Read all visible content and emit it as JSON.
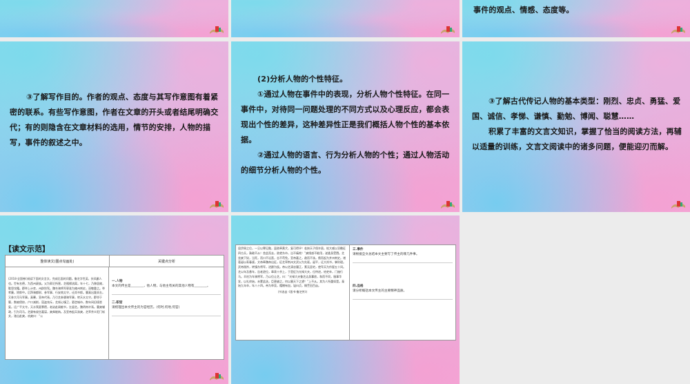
{
  "slides": {
    "s3": {
      "text": "事件的观点、情感、态度等。"
    },
    "s4": {
      "text": "③了解写作目的。作者的观点、态度与其写作意图有着紧密的联系。有些写作意图，作者在文章的开头或者结尾明确交代；有的则隐含在文章材料的选用，情节的安排，人物的描写，事件的叙述之中。"
    },
    "s5": {
      "heading": "(2)分析人物的个性特征。",
      "p1": "①通过人物在事件中的表现，分析人物个性特征。在同一事件中，对待同一问题处理的不同方式以及心理反应，都会表现出个性的差异，这种差异性正是我们概括人物个性的基本依据。",
      "p2": "②通过人物的语言、行为分析人物的个性；通过人物活动的细节分析人物的个性。"
    },
    "s6": {
      "p1": "③了解古代传记人物的基本类型：刚烈、忠贞、勇猛、爱国、诚信、孝悌、谦慎、勤勉、博闻、聪慧……",
      "p2": "积累了丰富的文言文知识，掌握了恰当的阅读方法，再辅以适量的训练，文言文阅读中的诸多问题，便能迎刃而解。"
    },
    "s7": {
      "title": "【读文示范】",
      "col1_header": "整体读文(圈点勾画处)",
      "col2_header": "关键点分析",
      "passage": "(2018·全国卷Ⅰ)阅读下面的文言文，完成后面的问题。鲁芝字世英，扶风郿人也。世有名德，为西州豪族。父为郭汜所害，芝襁褓流离，年十七，乃移居雍，耽思坟籍。郡举上计吏，州辟别驾。魏车骑将军郭淮为雍州刺史，深敬重之。举孝廉，除郎中。后拜骑都尉、参军事、行安南太守，迁尚书郎。曹真出督关右，又参大司马军事。真薨，宣帝代焉，乃引芝参骠骑军事，转天水太守。郡邻于蜀，数被侵掠，户口减削，寇盗充斥，芝倾心镇卫，更造城市，数年间旧境悉复。迁广平太守。天水夷夏慕德，老幼赴阙献书，乞留芝。魏明帝许焉。曹爽辅政，引为司马。芝屡有谠言嘉谋，爽弗能纳。及宣帝起兵诛爽，芝率余众犯门斩关，驰出赴爽，劝爽曰：“公",
      "q1_title": "一.人物",
      "q1_text": "本文的传主是________，他人物，与他主有关的其他人物有________。",
      "q2_title": "二.职官",
      "q2_text": "请梳理出本文传主的为官经历。(何时,何地,何官)"
    },
    "s8": {
      "passage": "居伊周之位，一旦以罪见黜，虽欲牵黄犬，复可得乎！若挟天子保许昌，杖大威以羽檄征四方兵，孰敢不从！舍此而去，欲就东市，岂不痛哉！”爽懦惑不能用，遂委身受戮。芝坐爽下狱，当死，而口不讼直，志不苟免。宣帝嘉之，赦而不诛。俄而起为并州刺史。诸葛诞以寿春叛，文帝奉魏帝出征，征芝率荆州文武以为先驱。诞平，迁大尚书，掌刑理。武帝践祚，转镇东将军，进爵为侯。帝以芝清忠履正，素无居宅，使军兵为作屋五十间。芝以年及悬车，告老逊位，章表十余上，于是征为光禄大夫，位特进，给吏卒，门施行马。羊祜为车骑将军，乃以位让芝，曰：“光禄大夫鲁芝洁身寡欲，和而不同，服事华发，以礼终始，未蒙此选，臣更越之，何以塞天下之望！”上不从。其为人所重如是。泰始九年卒，年八十四。帝为举哀，赗赠有加，谥曰贞，赐茔田百亩。",
      "source": "(节选自《晋书·鲁芝传》)",
      "q3_title": "三.事件",
      "q3_text": "请根据全文总结本文主要写了传主的哪几件事。",
      "q4_title": "四.品格",
      "q4_text": "请分析概括本文传主的主要精神品质。"
    }
  },
  "icons": [
    "book-scroll-icon"
  ],
  "colors": {
    "gradient_cyan": "#8fd8ef",
    "gradient_pink": "#f1a9d6",
    "text": "#1a1a1a"
  }
}
